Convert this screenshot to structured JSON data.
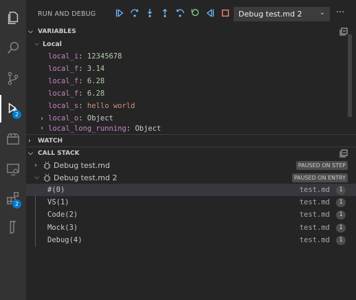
{
  "activity_bar": {
    "debug_badge": "2",
    "extensions_badge": "2"
  },
  "header": {
    "title": "RUN AND DEBUG",
    "config_selected": "Debug test.md 2",
    "more": "···"
  },
  "variables": {
    "title": "VARIABLES",
    "scope": "Local",
    "items": [
      {
        "name": "local_i",
        "value": "12345678",
        "kind": "num"
      },
      {
        "name": "local_f",
        "value": "3.14",
        "kind": "num"
      },
      {
        "name": "local_f",
        "value": "6.28",
        "kind": "num"
      },
      {
        "name": "local_f",
        "value": "6.28",
        "kind": "num"
      },
      {
        "name": "local_s",
        "value": "hello world",
        "kind": "str"
      },
      {
        "name": "local_o",
        "value": "Object",
        "kind": "obj"
      },
      {
        "name": "local_long_running",
        "value": "Object",
        "kind": "obj"
      }
    ]
  },
  "watch": {
    "title": "WATCH"
  },
  "call_stack": {
    "title": "CALL STACK",
    "sessions": [
      {
        "label": "Debug test.md",
        "state": "PAUSED ON STEP"
      },
      {
        "label": "Debug test.md 2",
        "state": "PAUSED ON ENTRY"
      }
    ],
    "frames": [
      {
        "name": "#(0)",
        "file": "test.md",
        "line": "1"
      },
      {
        "name": "VS(1)",
        "file": "test.md",
        "line": "1"
      },
      {
        "name": "Code(2)",
        "file": "test.md",
        "line": "1"
      },
      {
        "name": "Mock(3)",
        "file": "test.md",
        "line": "1"
      },
      {
        "name": "Debug(4)",
        "file": "test.md",
        "line": "1"
      }
    ]
  },
  "colors": {
    "accent": "#007acc",
    "var_name": "#c586c0",
    "var_number": "#b5cea8",
    "var_string": "#ce9178",
    "stop": "#f48771",
    "continue": "#75beff",
    "restart": "#89d185"
  },
  "icons": [
    "files-icon",
    "search-icon",
    "source-control-icon",
    "debug-icon",
    "extensions-icon",
    "remote-icon",
    "extension-pack-icon",
    "bookmark-icon"
  ]
}
